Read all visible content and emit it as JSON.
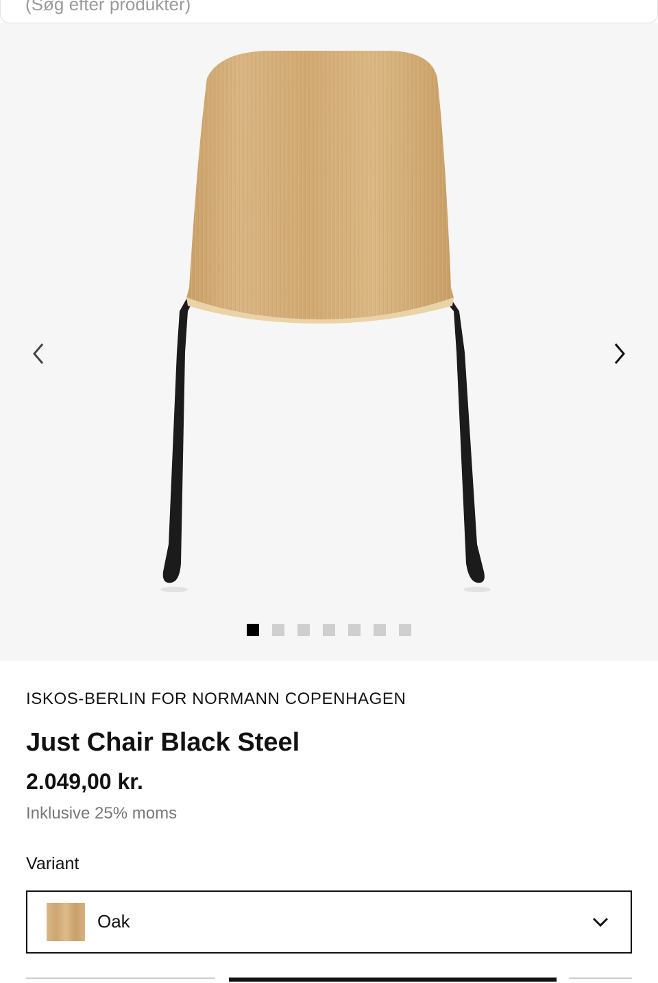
{
  "search": {
    "placeholder": "(Søg efter produkter)"
  },
  "gallery": {
    "image_alt": "Just Chair Black Steel - Oak",
    "prev_label": "Previous image",
    "next_label": "Next image",
    "slide_count": 7,
    "active_slide": 1
  },
  "product": {
    "brand": "ISKOS-BERLIN FOR NORMANN COPENHAGEN",
    "title": "Just Chair Black Steel",
    "price": "2.049,00 kr.",
    "vat_note": "Inklusive 25% moms"
  },
  "variant": {
    "label": "Variant",
    "selected": "Oak",
    "swatch_color": "#d3ae7c"
  },
  "colors": {
    "gallery_bg": "#f6f6f6",
    "text": "#111111",
    "muted": "#777777",
    "dot_inactive": "#cfcfcf",
    "dot_active": "#000000"
  }
}
